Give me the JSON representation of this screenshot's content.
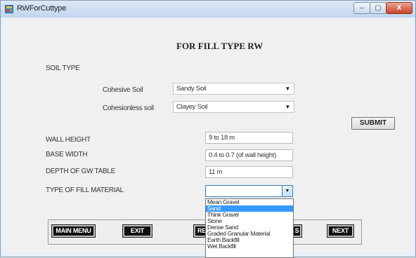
{
  "window": {
    "title": "RWForCuttype",
    "controls": [
      "–",
      "▢",
      "X"
    ]
  },
  "heading": "FOR FILL TYPE RW",
  "soil": {
    "section_label": "SOIL TYPE",
    "cohesive_label": "Cohesive Soil",
    "cohesive_value": "Sandy Soil",
    "cohesionless_label": "Cohesionless soil",
    "cohesionless_value": "Clayey Soil"
  },
  "submit_label": "SUBMIT",
  "fields": {
    "wall_height_label": "WALL HEIGHT",
    "wall_height_value": "9 to 18 m",
    "base_width_label": "BASE WIDTH",
    "base_width_value": "0.4 to 0.7 (of wall height)",
    "gw_depth_label": "DEPTH OF GW TABLE",
    "gw_depth_value": "11 m",
    "fill_material_label": "TYPE OF FILL MATERIAL",
    "fill_material_value": ""
  },
  "fill_options": [
    "Mean Gravel",
    "Sand",
    "Think Gravel",
    "Stone",
    "Dense  Sand",
    "Graded Granular Material",
    "Earth Backfill",
    "Wet Backfill"
  ],
  "fill_selected_index": 1,
  "nav": {
    "main_menu": "MAIN MENU",
    "exit": "EXIT",
    "partial_left": "RE",
    "partial_right": "S",
    "next": "NEXT"
  },
  "icons": {
    "dropdown": "▼"
  }
}
